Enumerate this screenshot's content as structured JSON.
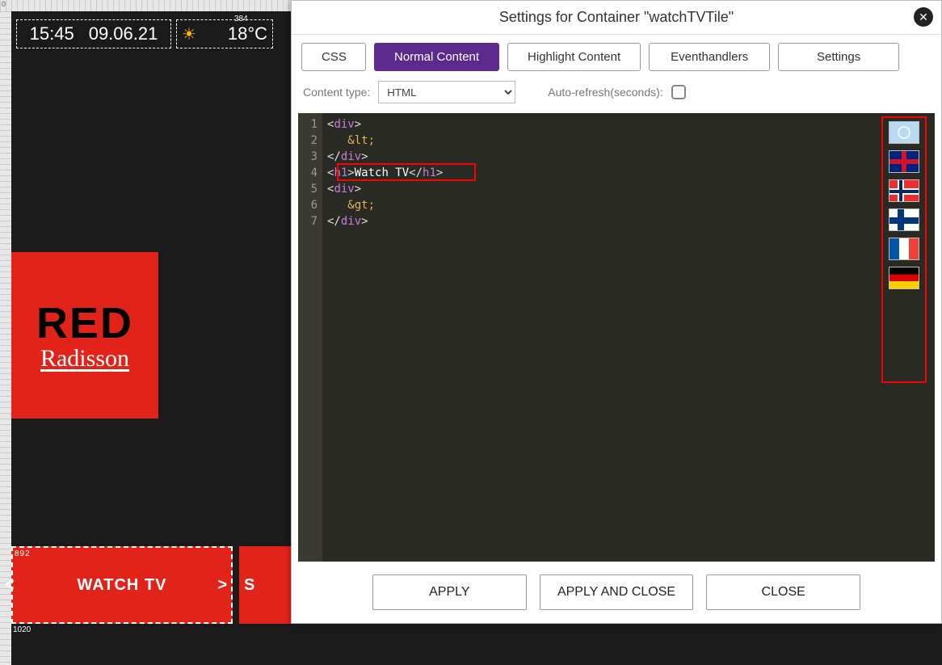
{
  "ruler": {
    "mark0": "0",
    "mark384": "384"
  },
  "status": {
    "time": "15:45",
    "date": "09.06.21",
    "temp": "18°C"
  },
  "logo": {
    "line1": "RED",
    "line2": "Radisson"
  },
  "tiles": {
    "watch": {
      "label": "WATCH TV",
      "coord": "892",
      "left_chev": "<",
      "right_chev": ">"
    },
    "next_initial": "S",
    "coord_below": "1020"
  },
  "panel": {
    "title": "Settings for Container \"watchTVTile\"",
    "tabs": {
      "css": "CSS",
      "normal": "Normal Content",
      "highlight": "Highlight Content",
      "event": "Eventhandlers",
      "settings": "Settings"
    },
    "content_type_label": "Content type:",
    "content_type_value": "HTML",
    "auto_refresh_label": "Auto-refresh(seconds):"
  },
  "code": {
    "lines": [
      "1",
      "2",
      "3",
      "4",
      "5",
      "6",
      "7"
    ],
    "l1": {
      "open": "<",
      "tag": "div",
      "close": ">"
    },
    "l2": {
      "amp": "&lt;"
    },
    "l3": {
      "open": "</",
      "tag": "div",
      "close": ">"
    },
    "l4": {
      "open1": "<",
      "tag1": "h1",
      "close1": ">",
      "text": "Watch TV",
      "open2": "</",
      "tag2": "h1",
      "close2": ">"
    },
    "l5": {
      "open": "<",
      "tag": "div",
      "close": ">"
    },
    "l6": {
      "amp": "&gt;"
    },
    "l7": {
      "open": "</",
      "tag": "div",
      "close": ">"
    }
  },
  "flags": [
    "un",
    "uk",
    "no",
    "fi",
    "fr",
    "de"
  ],
  "footer": {
    "apply": "APPLY",
    "apply_close": "APPLY AND CLOSE",
    "close": "CLOSE"
  }
}
